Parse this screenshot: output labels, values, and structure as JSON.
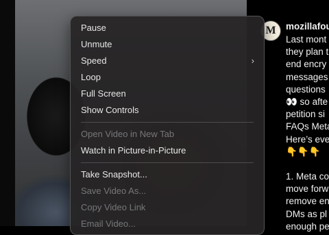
{
  "menu": {
    "items": [
      {
        "label": "Pause"
      },
      {
        "label": "Unmute"
      },
      {
        "label": "Speed"
      },
      {
        "label": "Loop"
      },
      {
        "label": "Full Screen"
      },
      {
        "label": "Show Controls"
      },
      {
        "label": "Open Video in New Tab"
      },
      {
        "label": "Watch in Picture-in-Picture"
      },
      {
        "label": "Take Snapshot..."
      },
      {
        "label": "Save Video As..."
      },
      {
        "label": "Copy Video Link"
      },
      {
        "label": "Email Video..."
      }
    ],
    "submenu_glyph": "›"
  },
  "post": {
    "avatar_letter": "M",
    "username": "mozillafou",
    "caption_lines": [
      "Last mont",
      "they plan t",
      "end encry",
      "messages",
      "questions",
      "👀 so afte",
      "petition si",
      "FAQs Meta",
      "Here’s eve",
      "👇👇👇",
      "",
      "1. Meta co",
      "move forw",
      "remove en",
      "DMs as pl",
      "enough pe"
    ]
  }
}
